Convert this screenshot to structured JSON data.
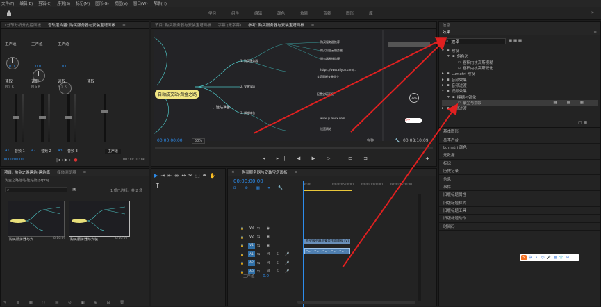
{
  "menu": {
    "items": [
      "文件(F)",
      "编辑(E)",
      "剪辑(C)",
      "序列(S)",
      "标记(M)",
      "图形(G)",
      "视图(V)",
      "窗口(W)",
      "帮助(H)"
    ]
  },
  "workspace": {
    "tabs": [
      "学习",
      "组件",
      "编辑",
      "颜色",
      "效果",
      "音频",
      "图形",
      "库"
    ],
    "more": "»"
  },
  "left_panel": {
    "tabs": [
      "1分节分析分支控面板",
      "音轨混合器: 购买服务器与安装宝塔面板",
      "≡"
    ],
    "channels": [
      {
        "route": "主声道",
        "pan": "0.0",
        "mode": "读取",
        "btns": "M S R",
        "name": "音频 1",
        "id": "A1"
      },
      {
        "route": "主声道",
        "pan": "0.0",
        "mode": "读取",
        "btns": "M S R",
        "name": "音频 2",
        "id": "A2"
      },
      {
        "route": "主声道",
        "pan": "0.0",
        "mode": "读取",
        "btns": "M S R",
        "name": "音频 3",
        "id": "A3"
      }
    ],
    "master": {
      "route": "读取",
      "name": "主声道",
      "meter": "dB"
    },
    "timecode": "00:00:00:00",
    "timecode_r": "00:00:10:09"
  },
  "program": {
    "tabs": [
      "节目: 购买服务器与安装宝塔面板",
      "字幕 (无字幕)",
      "参考: 购买服务器与安装宝塔面板",
      "≡"
    ],
    "timecode": "00:00:00:00",
    "zoom": "50%",
    "quality": "完整",
    "duration": "00:08:10:09",
    "mindmap": {
      "center": "自动成交站-淘金之路",
      "branch": "二、建站准备",
      "nodes": [
        "1. 购买服务器",
        "2. 安装宝塔",
        "3. 绑定域名",
        "购买服务器推荐",
        "购买阿里云服务器",
        "服务器系统选择",
        "https://www.aliyun.com/...",
        "宝塔面板安装命令",
        "配置宝塔面板",
        "www.guanxx.com",
        "设置网站"
      ],
      "badge": "38%",
      "sogou": "S中"
    }
  },
  "right_panel": {
    "title": "效果",
    "search": "遮罩",
    "tree": [
      {
        "label": "预设",
        "indent": 0,
        "arrow": "▾"
      },
      {
        "label": "斜角边",
        "indent": 1,
        "arrow": "▾"
      },
      {
        "label": "卷积内核高斯模糊",
        "indent": 2,
        "arrow": ""
      },
      {
        "label": "卷积内核高斯锐化",
        "indent": 2,
        "arrow": ""
      },
      {
        "label": "Lumetri 预设",
        "indent": 0,
        "arrow": "▸"
      },
      {
        "label": "音频效果",
        "indent": 0,
        "arrow": "▸"
      },
      {
        "label": "音频过渡",
        "indent": 0,
        "arrow": "▸"
      },
      {
        "label": "视频效果",
        "indent": 0,
        "arrow": "▾"
      },
      {
        "label": "模糊与锐化",
        "indent": 1,
        "arrow": "▾"
      },
      {
        "label": "蒙尘与划痕",
        "indent": 2,
        "arrow": "",
        "selected": true
      },
      {
        "label": "视频过渡",
        "indent": 0,
        "arrow": "▸"
      }
    ],
    "sections": [
      "基本图形",
      "基本声音",
      "Lumetri 颜色",
      "元数据",
      "标记",
      "历史记录",
      "信息",
      "事件",
      "旧版标题属性",
      "旧版标题样式",
      "旧版标题工具",
      "旧版标题动作",
      "时间码"
    ]
  },
  "project": {
    "tabs": [
      "项目: 淘金之路建站-建站篇",
      "媒体浏览器",
      "≡"
    ],
    "path": "淘金之路建站-建站篇.prproj",
    "count": "1 项已选择，共 2 项",
    "items": [
      {
        "name": "购买服务器与安...",
        "dur": "8:10:09"
      },
      {
        "name": "购买服务器与安装...",
        "dur": "8:10:09"
      }
    ]
  },
  "timeline": {
    "tab": "购买服务器与安装宝塔面板",
    "timecode": "00:00:00:00",
    "ruler": [
      "00:00",
      "00:00:05:00:00",
      "00:00:10:00:00",
      "00:00:15:00:00"
    ],
    "tracks": [
      {
        "id": "V3",
        "type": "v"
      },
      {
        "id": "V2",
        "type": "v"
      },
      {
        "id": "V1",
        "type": "v",
        "sel": true
      },
      {
        "id": "A1",
        "type": "a",
        "sel": true
      },
      {
        "id": "A2",
        "type": "a",
        "sel": true
      },
      {
        "id": "A3",
        "type": "a",
        "sel": true
      }
    ],
    "master": {
      "label": "主声道",
      "value": "0.0"
    },
    "clip": "购买服务器与安装宝塔面板 [V]",
    "ime": [
      "中",
      "•",
      "☺",
      "🎤",
      "▦",
      "👕",
      "⊞"
    ]
  },
  "colors": {
    "accent": "#2d8ceb",
    "arrow": "#e02020",
    "clip_video": "#6a8fb8",
    "clip_audio": "#4f7fb0",
    "yellow": "#e8c63a"
  }
}
